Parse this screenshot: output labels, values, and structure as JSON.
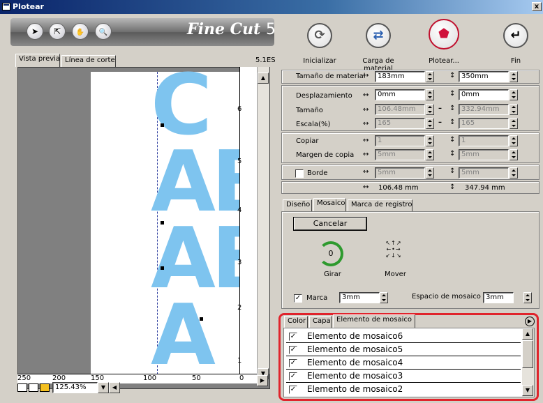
{
  "window": {
    "title": "Plotear",
    "close": "x"
  },
  "logo": {
    "name": "Fine Cut",
    "version": "5"
  },
  "toolbar": {
    "arrow_tool": "➤",
    "select_tool": "⇱",
    "hand_tool": "✋",
    "zoom_tool": "🔍"
  },
  "actions": [
    {
      "label": "Inicializar"
    },
    {
      "label": "Carga de material"
    },
    {
      "label": "Plotear..."
    },
    {
      "label": "Fin"
    }
  ],
  "preview": {
    "tabs": [
      "Vista previa",
      "Línea de corte"
    ],
    "device": "5.1ES",
    "zoom": "125.43%",
    "h_ticks": [
      "250",
      "200",
      "150",
      "100",
      "50",
      "0"
    ],
    "v_ticks": [
      "6",
      "5",
      "4",
      "3",
      "2",
      "1"
    ],
    "artwork_letters": [
      "C",
      "AB",
      "AB",
      "A"
    ],
    "artwork_color": "#7ec4ef"
  },
  "material": {
    "label": "Tamaño de material",
    "width": "183mm",
    "height": "350mm"
  },
  "offset": {
    "label": "Desplazamiento",
    "x": "0mm",
    "y": "0mm"
  },
  "size": {
    "label": "Tamaño",
    "x": "106.48mm",
    "y": "332.94mm"
  },
  "scale": {
    "label": "Escala(%)",
    "x": "165",
    "y": "165"
  },
  "copy": {
    "label": "Copiar",
    "x": "1",
    "y": "1"
  },
  "copy_margin": {
    "label": "Margen de copia",
    "x": "5mm",
    "y": "5mm"
  },
  "border": {
    "label": "Borde",
    "x": "5mm",
    "y": "5mm",
    "checked": false
  },
  "result": {
    "x": "106.48 mm",
    "y": "347.94 mm"
  },
  "tabs2": [
    "Diseño",
    "Mosaico",
    "Marca de registro"
  ],
  "mosaic": {
    "cancel": "Cancelar",
    "rotate_label": "Girar",
    "rotate_value": "0",
    "move_label": "Mover",
    "mark_label": "Marca",
    "mark_checked": true,
    "mark_value": "3mm",
    "spacing_label": "Espacio de mosaico",
    "spacing_value": "3mm"
  },
  "tabs3": [
    "Color",
    "Capa",
    "Elemento de mosaico"
  ],
  "list": [
    {
      "label": "Elemento de mosaico6",
      "checked": true
    },
    {
      "label": "Elemento de mosaico5",
      "checked": true
    },
    {
      "label": "Elemento de mosaico4",
      "checked": true
    },
    {
      "label": "Elemento de mosaico3",
      "checked": true
    },
    {
      "label": "Elemento de mosaico2",
      "checked": true
    }
  ],
  "accent": {
    "highlight": "#e0242c",
    "arrow_green": "#2e9a2e",
    "plot_red": "#d0103a"
  }
}
